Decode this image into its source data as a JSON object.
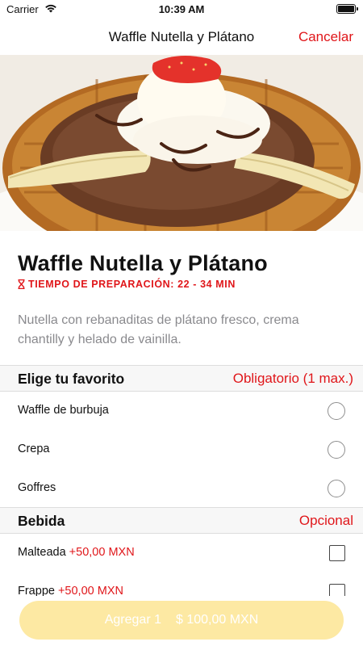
{
  "status_bar": {
    "carrier": "Carrier",
    "time": "10:39 AM"
  },
  "nav": {
    "title": "Waffle Nutella y Plátano",
    "cancel_label": "Cancelar"
  },
  "product": {
    "name": "Waffle Nutella y Plátano",
    "prep_time": "TIEMPO DE PREPARACIÓN: 22 - 34 MIN",
    "description": "Nutella con rebanaditas de plátano fresco, crema chantilly y helado de vainilla."
  },
  "sections": [
    {
      "title": "Elige tu favorito",
      "tag": "Obligatorio (1 max.)",
      "options": [
        {
          "label": "Waffle de burbuja"
        },
        {
          "label": "Crepa"
        },
        {
          "label": "Goffres"
        }
      ]
    },
    {
      "title": "Bebida",
      "tag": "Opcional",
      "options": [
        {
          "label": "Malteada",
          "price": "+50,00 MXN"
        },
        {
          "label": "Frappe",
          "price": "+50,00 MXN"
        }
      ]
    }
  ],
  "add_button": {
    "label": "Agregar 1",
    "price": "$ 100,00 MXN"
  },
  "colors": {
    "accent": "#e0161a",
    "button_bg": "#fde9a3"
  },
  "icons": [
    "wifi-icon",
    "battery-icon",
    "hourglass-icon",
    "radio-button",
    "checkbox"
  ]
}
